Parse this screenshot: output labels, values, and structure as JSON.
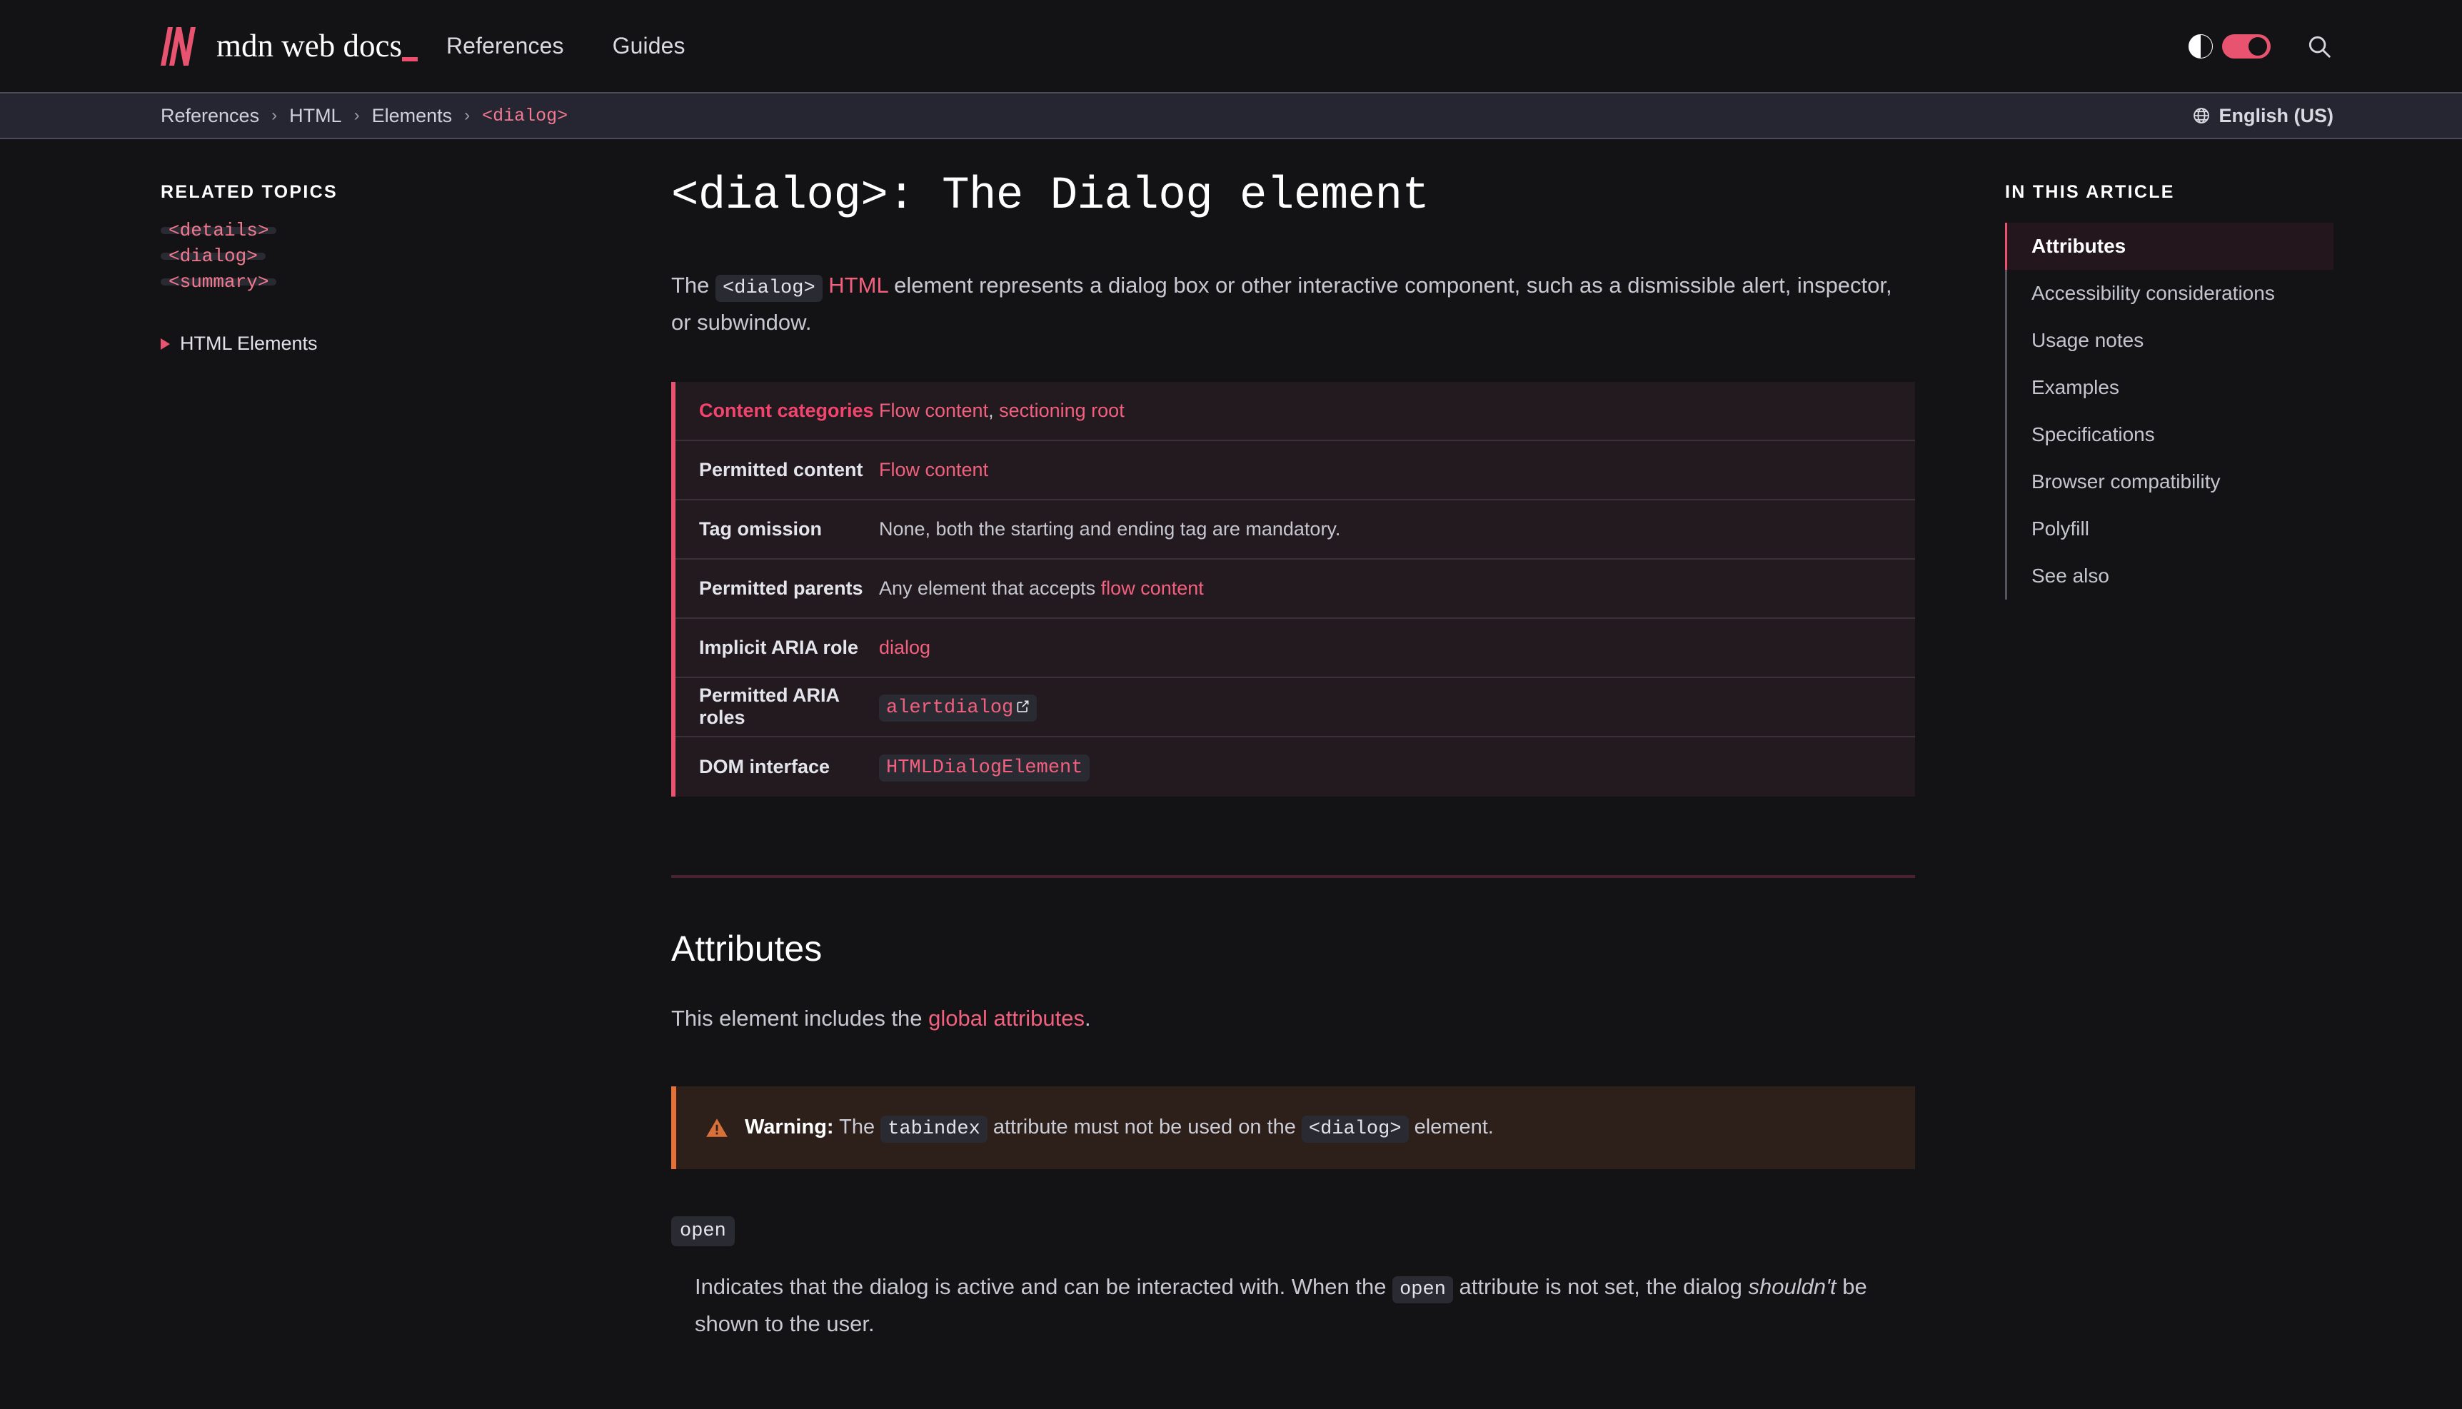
{
  "header": {
    "logo_text": "mdn web docs",
    "logo_icon": "mdn-m-logo",
    "nav": [
      {
        "label": "References"
      },
      {
        "label": "Guides"
      }
    ],
    "theme_toggle_icon": "half-circle-contrast-icon",
    "theme_toggle_state": "on",
    "search_icon": "search-icon",
    "accent_color": "#e8546f"
  },
  "breadcrumb": {
    "items": [
      {
        "label": "References",
        "current": false
      },
      {
        "label": "HTML",
        "current": false
      },
      {
        "label": "Elements",
        "current": false
      },
      {
        "label": "<dialog>",
        "current": true
      }
    ],
    "separator": "›",
    "language": {
      "icon": "globe-icon",
      "label": "English (US)"
    }
  },
  "sidebar": {
    "title": "RELATED TOPICS",
    "links": [
      {
        "label": "<details>"
      },
      {
        "label": "<dialog>"
      },
      {
        "label": "<summary>"
      }
    ],
    "tree": {
      "label": "HTML Elements",
      "icon": "triangle-right-icon"
    }
  },
  "main": {
    "title": "<dialog>: The Dialog element",
    "lead": {
      "part1": "The",
      "code": "<dialog>",
      "link": "HTML",
      "part2": "element represents a dialog box or other interactive component, such as a dismissible alert, inspector, or subwindow."
    },
    "properties": {
      "rows": [
        {
          "key": "Content categories",
          "value_links": [
            "Flow content",
            "sectioning root"
          ],
          "value_separator": ", ",
          "highlight": true
        },
        {
          "key": "Permitted content",
          "value_links": [
            "Flow content"
          ],
          "highlight": false
        },
        {
          "key": "Tag omission",
          "value_text": "None, both the starting and ending tag are mandatory.",
          "highlight": false
        },
        {
          "key": "Permitted parents",
          "value_prefix": "Any element that accepts ",
          "value_links": [
            "flow content"
          ],
          "highlight": false
        },
        {
          "key": "Implicit ARIA role",
          "value_links": [
            "dialog"
          ],
          "highlight": false
        },
        {
          "key": "Permitted ARIA roles",
          "value_code_link": "alertdialog",
          "external_icon": "external-link-icon",
          "highlight": false
        },
        {
          "key": "DOM interface",
          "value_code_link": "HTMLDialogElement",
          "highlight": false
        }
      ]
    },
    "attributes_section": {
      "heading": "Attributes",
      "intro_prefix": "This element includes the ",
      "intro_link": "global attributes",
      "intro_suffix": ".",
      "warning": {
        "icon": "warning-triangle-icon",
        "label": "Warning:",
        "text_part1": "The",
        "code1": "tabindex",
        "text_part2": "attribute must not be used on the",
        "code2": "<dialog>",
        "text_part3": "element."
      },
      "definition": {
        "term": "open",
        "desc_part1": "Indicates that the dialog is active and can be interacted with. When the",
        "desc_code": "open",
        "desc_part2": "attribute is not set, the dialog",
        "desc_italic": "shouldn't",
        "desc_part3": "be shown to the user."
      }
    }
  },
  "toc": {
    "title": "IN THIS ARTICLE",
    "items": [
      {
        "label": "Attributes",
        "active": true
      },
      {
        "label": "Accessibility considerations",
        "active": false
      },
      {
        "label": "Usage notes",
        "active": false
      },
      {
        "label": "Examples",
        "active": false
      },
      {
        "label": "Specifications",
        "active": false
      },
      {
        "label": "Browser compatibility",
        "active": false
      },
      {
        "label": "Polyfill",
        "active": false
      },
      {
        "label": "See also",
        "active": false
      }
    ]
  }
}
